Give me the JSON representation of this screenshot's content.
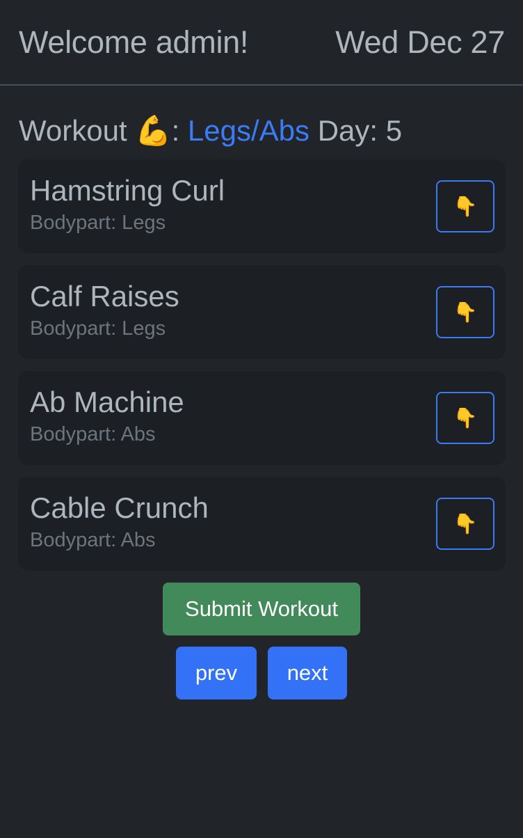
{
  "header": {
    "welcome": "Welcome admin!",
    "date": "Wed Dec 27"
  },
  "workout": {
    "label": "Workout 💪:",
    "name": "Legs/Abs",
    "day_label": "Day: 5"
  },
  "exercises": [
    {
      "name": "Hamstring Curl",
      "bodypart": "Bodypart: Legs",
      "button_icon": "👇"
    },
    {
      "name": "Calf Raises",
      "bodypart": "Bodypart: Legs",
      "button_icon": "👇"
    },
    {
      "name": "Ab Machine",
      "bodypart": "Bodypart: Abs",
      "button_icon": "👇"
    },
    {
      "name": "Cable Crunch",
      "bodypart": "Bodypart: Abs",
      "button_icon": "👇"
    }
  ],
  "actions": {
    "submit_label": "Submit Workout",
    "prev_label": "prev",
    "next_label": "next"
  },
  "colors": {
    "background": "#212529",
    "card": "#1c1f23",
    "accent": "#3b7bf6",
    "submit": "#428a5a",
    "nav_button": "#3371f6"
  }
}
